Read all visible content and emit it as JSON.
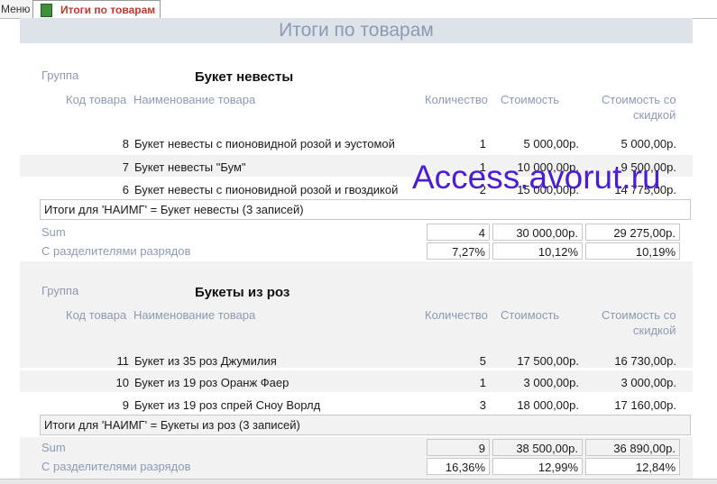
{
  "tabs": {
    "menu_label": "Меню",
    "active_label": "Итоги по товарам"
  },
  "report": {
    "title": "Итоги по товарам"
  },
  "labels": {
    "group": "Группа",
    "code": "Код товара",
    "name": "Наименование товара",
    "qty": "Количество",
    "cost": "Стоимость",
    "cost_disc_1": "Стоимость со",
    "cost_disc_2": "скидкой",
    "sum": "Sum",
    "separators": "С разделителями разрядов"
  },
  "groups": [
    {
      "name": "Букет невесты",
      "rows": [
        {
          "code": "8",
          "name": "Букет невесты с пионовидной розой и эустомой",
          "qty": "1",
          "cost": "5 000,00р.",
          "disc": "5 000,00р."
        },
        {
          "code": "7",
          "name": "Букет невесты \"Бум\"",
          "qty": "1",
          "cost": "10 000,00р.",
          "disc": "9 500,00р."
        },
        {
          "code": "6",
          "name": "Букет невесты с пионовидной розой и гвоздикой",
          "qty": "2",
          "cost": "15 000,00р.",
          "disc": "14 775,00р."
        }
      ],
      "footer": "Итоги для 'НАИМГ' =  Букет невесты (3 записей)",
      "sum_qty": "4",
      "sum_cost": "30 000,00р.",
      "sum_disc": "29 275,00р.",
      "pct_qty": "7,27%",
      "pct_cost": "10,12%",
      "pct_disc": "10,19%"
    },
    {
      "name": "Букеты из роз",
      "rows": [
        {
          "code": "11",
          "name": "Букет из 35 роз Джумилия",
          "qty": "5",
          "cost": "17 500,00р.",
          "disc": "16 730,00р."
        },
        {
          "code": "10",
          "name": "Букет из 19 роз Оранж Фаер",
          "qty": "1",
          "cost": "3 000,00р.",
          "disc": "3 000,00р."
        },
        {
          "code": "9",
          "name": "Букет из 19 роз спрей Сноу Ворлд",
          "qty": "3",
          "cost": "18 000,00р.",
          "disc": "17 160,00р."
        }
      ],
      "footer": "Итоги для 'НАИМГ' =  Букеты из роз (3 записей)",
      "sum_qty": "9",
      "sum_cost": "38 500,00р.",
      "sum_disc": "36 890,00р.",
      "pct_qty": "16,36%",
      "pct_cost": "12,99%",
      "pct_disc": "12,84%"
    }
  ],
  "watermark": "Access.avorut.ru"
}
